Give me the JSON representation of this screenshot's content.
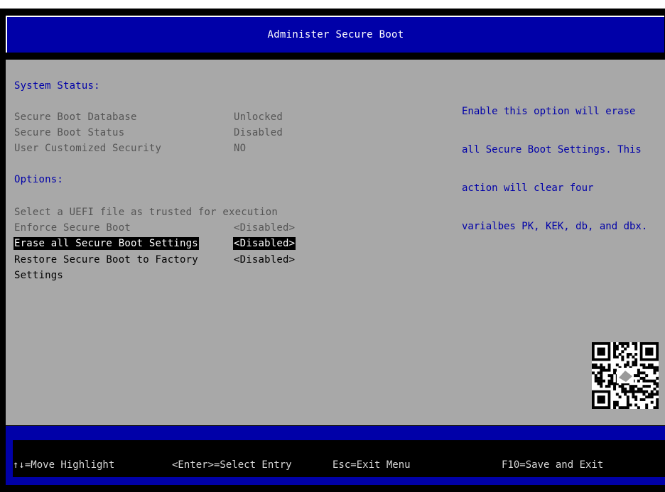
{
  "title": "Administer Secure Boot",
  "system_status": {
    "heading": "System Status:",
    "rows": [
      {
        "label": "Secure Boot Database",
        "value": "Unlocked"
      },
      {
        "label": "Secure Boot Status",
        "value": "Disabled"
      },
      {
        "label": "User Customized Security",
        "value": "NO"
      }
    ]
  },
  "options": {
    "heading": "Options:",
    "trusted_file": "Select a UEFI file as trusted for execution",
    "items": [
      {
        "label": "Enforce Secure Boot",
        "value": "<Disabled>"
      },
      {
        "label": "Erase all Secure Boot Settings",
        "value": "<Disabled>"
      },
      {
        "label": "Restore Secure Boot to Factory",
        "label_line2": "Settings",
        "value": "<Disabled>"
      }
    ]
  },
  "help_text": [
    "Enable this option will erase",
    "all Secure Boot Settings. This",
    "action will clear four",
    "varialbes PK, KEK, db, and dbx."
  ],
  "footer": {
    "move": "↑↓=Move Highlight",
    "select": "<Enter>=Select Entry",
    "exit": "Esc=Exit Menu",
    "save": "F10=Save and Exit"
  },
  "icons": {
    "qr": "qr-code-icon"
  },
  "colors": {
    "title_bar": "#0000a8",
    "body": "#a8a8a8",
    "heading": "#0000a8",
    "highlight_bg": "#000000",
    "highlight_fg": "#ffffff"
  }
}
